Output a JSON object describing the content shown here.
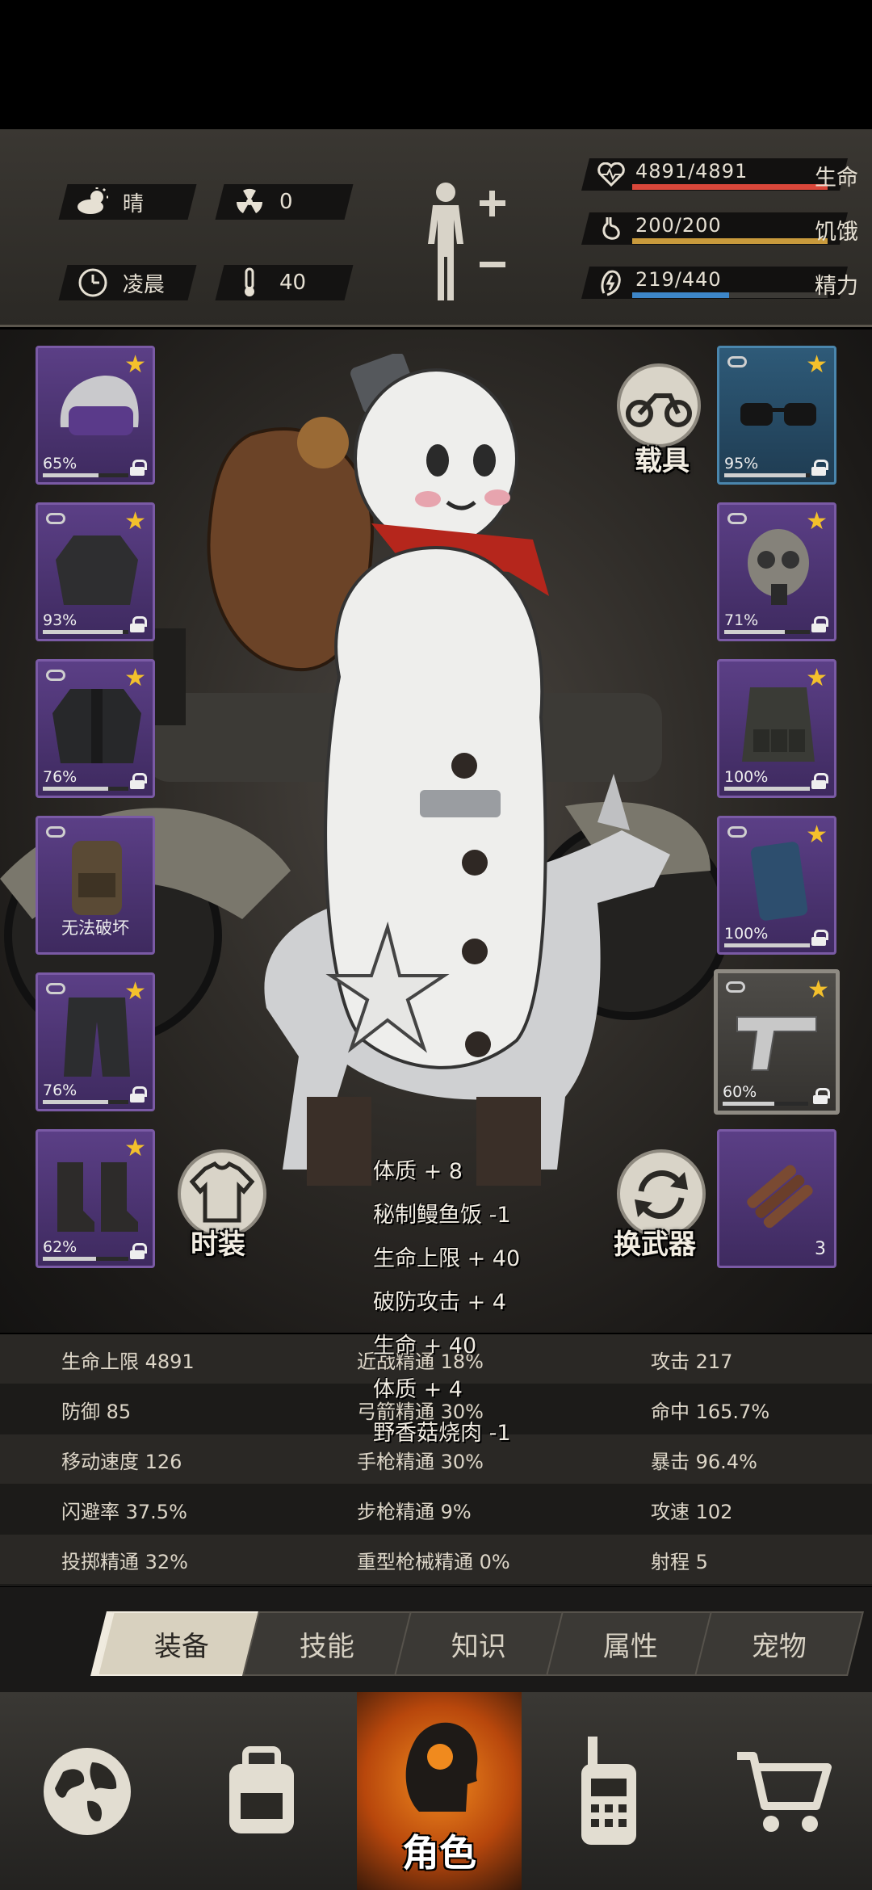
{
  "status": {
    "weather": "晴",
    "radiation": "0",
    "time_of_day": "凌晨",
    "temperature": "40",
    "bars": [
      {
        "label": "生命",
        "value": "4891/4891",
        "fraction": 1.0,
        "color": "#d9473a",
        "icon": "heart-icon"
      },
      {
        "label": "饥饿",
        "value": "200/200",
        "fraction": 1.0,
        "color": "#c99a3c",
        "icon": "stomach-icon"
      },
      {
        "label": "精力",
        "value": "219/440",
        "fraction": 0.4977,
        "color": "#3d86c8",
        "icon": "energy-icon"
      }
    ]
  },
  "slots_left": [
    {
      "item": "police-helmet",
      "pct": "65%",
      "durability": 0.65,
      "star": "★",
      "linked": false
    },
    {
      "item": "jacket",
      "pct": "93%",
      "durability": 0.93,
      "star": "★",
      "linked": true
    },
    {
      "item": "tactical-coat",
      "pct": "76%",
      "durability": 0.76,
      "star": "★",
      "linked": true
    },
    {
      "item": "backpack",
      "unbreakable_text": "无法破坏",
      "linked": true
    },
    {
      "item": "cargo-pants",
      "pct": "76%",
      "durability": 0.76,
      "star": "★",
      "linked": true
    },
    {
      "item": "boots",
      "pct": "62%",
      "durability": 0.62,
      "star": "★",
      "linked": false
    }
  ],
  "slots_right": [
    {
      "item": "sunglasses",
      "pct": "95%",
      "durability": 0.95,
      "star": "★",
      "linked": true
    },
    {
      "item": "gas-mask",
      "pct": "71%",
      "durability": 0.71,
      "star": "★",
      "linked": true
    },
    {
      "item": "tactical-vest",
      "pct": "100%",
      "durability": 1.0,
      "star": "★",
      "linked": false
    },
    {
      "item": "riot-shield",
      "pct": "100%",
      "durability": 1.0,
      "star": "★",
      "linked": true
    },
    {
      "item": "desert-eagle",
      "pct": "60%",
      "durability": 0.6,
      "star": "★",
      "linked": true
    },
    {
      "item": "dynamite",
      "count": "3"
    }
  ],
  "buttons": {
    "vehicle": "载具",
    "fashion": "时装",
    "switch_weapon": "换武器"
  },
  "float_texts": [
    "体质 + 8",
    "秘制鳗鱼饭 -1",
    "生命上限 + 40",
    "破防攻击 + 4",
    "生命 + 40",
    "体质 + 4",
    "野香菇烧肉 -1"
  ],
  "stats": [
    [
      "生命上限 4891",
      "近战精通 18%",
      "攻击 217"
    ],
    [
      "防御 85",
      "弓箭精通 30%",
      "命中 165.7%"
    ],
    [
      "移动速度 126",
      "手枪精通 30%",
      "暴击 96.4%"
    ],
    [
      "闪避率 37.5%",
      "步枪精通 9%",
      "攻速 102"
    ],
    [
      "投掷精通 32%",
      "重型枪械精通 0%",
      "射程 5"
    ]
  ],
  "tabs": [
    "装备",
    "技能",
    "知识",
    "属性",
    "宠物"
  ],
  "active_tab": 0,
  "nav": {
    "active_label": "角色",
    "items": [
      "globe-icon",
      "backpack-icon",
      "character-icon",
      "walkie-talkie-icon",
      "shopping-cart-icon"
    ]
  }
}
